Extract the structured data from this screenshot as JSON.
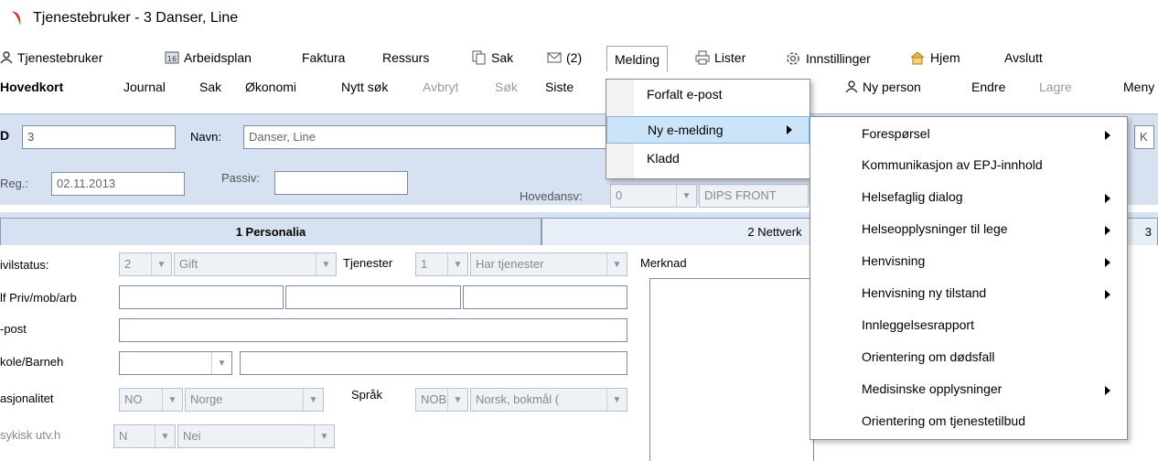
{
  "window": {
    "title": "Tjenestebruker - 3 Danser, Line"
  },
  "menubar": {
    "items": [
      {
        "label": "Tjenestebruker",
        "icon": "person-icon"
      },
      {
        "label": "Arbeidsplan",
        "icon": "calendar-icon"
      },
      {
        "label": "Faktura"
      },
      {
        "label": "Ressurs"
      },
      {
        "label": "Sak",
        "icon": "copy-icon"
      },
      {
        "label": "(2)",
        "icon": "mail-icon"
      },
      {
        "label": "Melding"
      },
      {
        "label": "Lister",
        "icon": "printer-icon"
      },
      {
        "label": "Innstillinger",
        "icon": "gear-icon"
      },
      {
        "label": "Hjem",
        "icon": "home-icon"
      },
      {
        "label": "Avslutt"
      }
    ]
  },
  "toolbar": {
    "items": [
      "Hovedkort",
      "Journal",
      "Sak",
      "Økonomi",
      "Nytt søk",
      "Avbryt",
      "Søk",
      "Siste",
      "Ny person",
      "Endre",
      "Lagre",
      "Meny"
    ]
  },
  "form": {
    "id_label": "D",
    "id_value": "3",
    "name_label": "Navn:",
    "name_value": "Danser, Line",
    "reg_label": "Reg.:",
    "reg_value": "02.11.2013",
    "passiv_label": "Passiv:",
    "passiv_value": "",
    "hovedansv_label": "Hovedansv:",
    "hovedansv_code": "0",
    "hovedansv_value": "DIPS FRONT",
    "k_label": "K"
  },
  "tabs": [
    {
      "label": "1 Personalia",
      "selected": true
    },
    {
      "label": "2 Nettverk",
      "selected": false
    },
    {
      "label": "3",
      "selected": false
    }
  ],
  "personalia": {
    "sivilstatus_label": "ivilstatus:",
    "sivilstatus_code": "2",
    "sivilstatus_value": "Gift",
    "tjenester_label": "Tjenester",
    "tjenester_code": "1",
    "tjenester_value": "Har tjenester",
    "merknad_label": "Merknad",
    "tlf_label": "lf Priv/mob/arb",
    "epost_label": "-post",
    "skole_label": "kole/Barneh",
    "nasjonalitet_label": "asjonalitet",
    "nasjonalitet_code": "NO",
    "nasjonalitet_value": "Norge",
    "sprak_label": "Språk",
    "sprak_code": "NOB",
    "sprak_value": "Norsk, bokmål (",
    "psykisk_label": "sykisk utv.h",
    "psykisk_code": "N",
    "psykisk_value": "Nei"
  },
  "melding_menu": {
    "items": [
      {
        "label": "Forfalt e-post",
        "submenu": false,
        "highlighted": false
      },
      {
        "label": "Ny e-melding",
        "submenu": true,
        "highlighted": true
      },
      {
        "label": "Kladd",
        "submenu": false,
        "highlighted": false
      }
    ]
  },
  "emelding_submenu": {
    "items": [
      {
        "label": "Forespørsel",
        "submenu": true
      },
      {
        "label": "Kommunikasjon av EPJ-innhold",
        "submenu": false
      },
      {
        "label": "Helsefaglig dialog",
        "submenu": true
      },
      {
        "label": "Helseopplysninger til lege",
        "submenu": true
      },
      {
        "label": "Henvisning",
        "submenu": true
      },
      {
        "label": "Henvisning ny tilstand",
        "submenu": true
      },
      {
        "label": "Innleggelsesrapport",
        "submenu": false
      },
      {
        "label": "Orientering om dødsfall",
        "submenu": false
      },
      {
        "label": "Medisinske opplysninger",
        "submenu": true
      },
      {
        "label": "Orientering om tjenestetilbud",
        "submenu": false
      }
    ]
  },
  "colors": {
    "form_bg": "#d6e2f2",
    "menu_highlight": "#cce4f7",
    "logo": "#d9322b"
  }
}
